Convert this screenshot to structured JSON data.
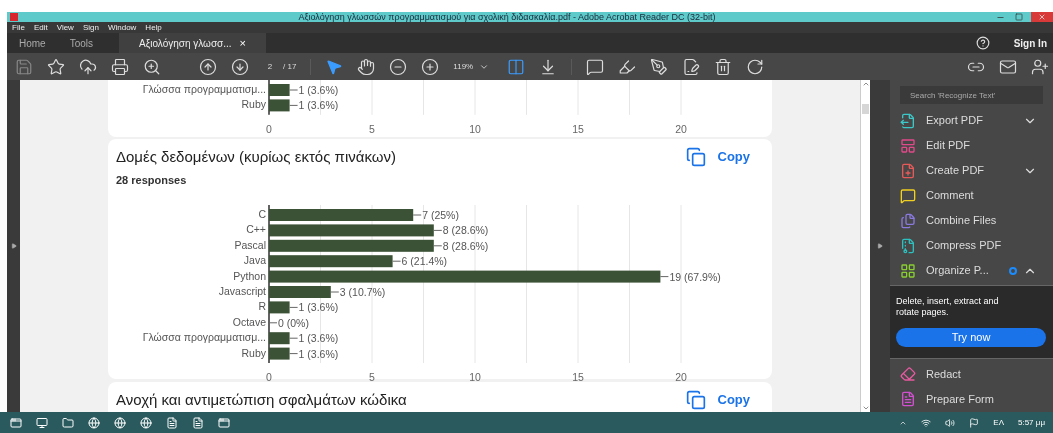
{
  "window": {
    "title": "Αξιολόγηση γλωσσών προγραμματισμού για σχολική διδασκαλία.pdf - Adobe Acrobat Reader DC (32-bit)"
  },
  "menu": [
    "File",
    "Edit",
    "View",
    "Sign",
    "Window",
    "Help"
  ],
  "tabs": [
    {
      "label": "Home",
      "selected": false
    },
    {
      "label": "Tools",
      "selected": false
    },
    {
      "label": "Αξιολόγηση γλωσσ...",
      "selected": true,
      "close": "×"
    }
  ],
  "sign_in": "Sign In",
  "toolbar": {
    "page_current": "2",
    "page_total": "/ 17",
    "zoom": "119%"
  },
  "cards": [
    {
      "kind": "partial",
      "chart_data": {
        "type": "bar",
        "orientation": "horizontal",
        "categories": [
          "Γλώσσα προγραμματισμ...",
          "Ruby"
        ],
        "values": [
          1,
          1
        ],
        "grid": true,
        "xlim": [
          0,
          20
        ],
        "xticks": [
          0,
          5,
          10,
          15,
          20
        ],
        "value_labels": [
          "1 (3.6%)",
          "1 (3.6%)"
        ]
      }
    },
    {
      "kind": "full",
      "title": "Δομές δεδομένων (κυρίως εκτός πινάκων)",
      "copy": "Copy",
      "responses": "28 responses",
      "chart_data": {
        "type": "bar",
        "orientation": "horizontal",
        "categories": [
          "C",
          "C++",
          "Pascal",
          "Java",
          "Python",
          "Javascript",
          "R",
          "Octave",
          "Γλώσσα προγραμματισμ...",
          "Ruby"
        ],
        "values": [
          7,
          8,
          8,
          6,
          19,
          3,
          1,
          0,
          1,
          1
        ],
        "grid": true,
        "xlim": [
          0,
          20
        ],
        "xticks": [
          0,
          5,
          10,
          15,
          20
        ],
        "value_labels": [
          "7 (25%)",
          "8 (28.6%)",
          "8 (28.6%)",
          "6 (21.4%)",
          "19 (67.9%)",
          "3 (10.7%)",
          "1 (3.6%)",
          "0 (0%)",
          "1 (3.6%)",
          "1 (3.6%)"
        ]
      }
    },
    {
      "kind": "title-only",
      "title": "Ανοχή και αντιμετώπιση σφαλμάτων κώδικα",
      "copy": "Copy"
    }
  ],
  "right_panel": {
    "search": {
      "placeholder": "Search 'Recognize Text'"
    },
    "tools": [
      {
        "kind": "export",
        "label": "Export PDF",
        "expanded": false
      },
      {
        "kind": "edit",
        "label": "Edit PDF"
      },
      {
        "kind": "create",
        "label": "Create PDF",
        "expanded": false
      },
      {
        "kind": "comment",
        "label": "Comment"
      },
      {
        "kind": "combine",
        "label": "Combine Files"
      },
      {
        "kind": "compress",
        "label": "Compress PDF"
      },
      {
        "kind": "organize",
        "label": "Organize P...",
        "new_dot": true,
        "expanded": true,
        "description": "Delete, insert, extract and rotate pages.",
        "action": "Try now"
      },
      {
        "kind": "redact",
        "label": "Redact"
      },
      {
        "kind": "form",
        "label": "Prepare Form"
      }
    ]
  },
  "taskbar": {
    "language": "ΕΛ",
    "time": "5:57 μμ"
  }
}
